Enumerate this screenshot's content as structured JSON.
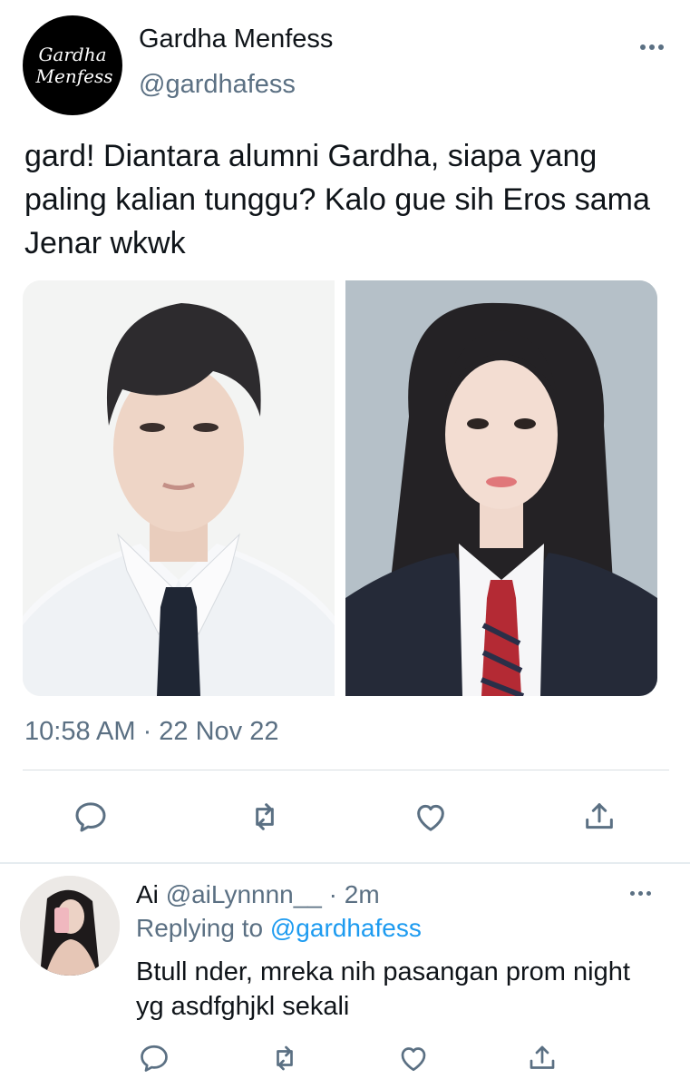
{
  "tweet": {
    "account_name": "Gardha Menfess",
    "handle": "@gardhafess",
    "avatar_text": [
      "Gardha",
      "Menfess"
    ],
    "text": "gard! Diantara alumni Gardha, siapa yang paling kalian tunggu? Kalo gue sih Eros sama Jenar wkwk",
    "timestamp": "10:58 AM · 22 Nov 22",
    "actions": [
      "reply-icon",
      "retweet-icon",
      "like-icon",
      "share-icon"
    ]
  },
  "reply": {
    "name": "Ai",
    "handle": "@aiLynnnn__",
    "time": "· 2m",
    "replying_prefix": "Replying to",
    "replying_to": "@gardhafess",
    "text": "Btull nder, mreka nih pasangan prom night yg asdfghjkl sekali",
    "actions": [
      "reply-icon",
      "retweet-icon",
      "like-icon",
      "share-icon"
    ]
  },
  "colors": {
    "text": "#0f1419",
    "secondary": "#5b7083",
    "link": "#1d9bf0",
    "divider": "#d9dee2"
  }
}
